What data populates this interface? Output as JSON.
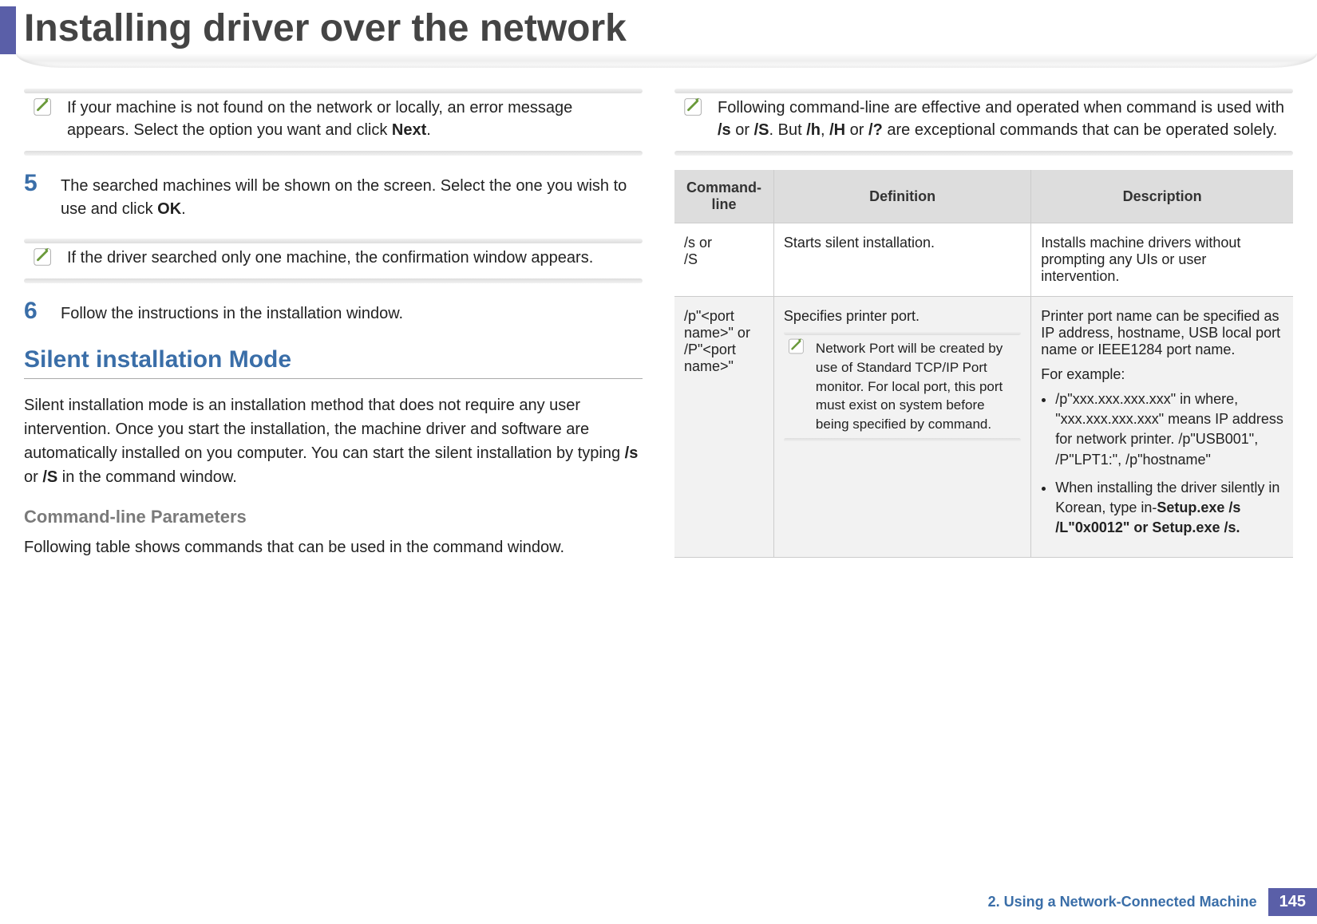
{
  "header": {
    "title": "Installing driver over the network"
  },
  "left": {
    "note1_a": "If your machine is not found on the network or locally, an error message appears. Select the option you want and click ",
    "note1_b": "Next",
    "note1_c": ".",
    "step5_num": "5",
    "step5_a": "The searched machines will be shown on the screen. Select the one you wish to use and click ",
    "step5_b": "OK",
    "step5_c": ".",
    "note2": "If the driver searched only one machine, the confirmation window appears.",
    "step6_num": "6",
    "step6": "Follow the instructions in the installation window.",
    "subheading": "Silent installation Mode",
    "para_a": "Silent installation mode is an installation method that does not require any user intervention. Once you start the installation, the machine driver and software are automatically installed on you computer. You can start the silent installation by typing ",
    "para_b": "/s",
    "para_c": " or ",
    "para_d": "/S",
    "para_e": " in the command window.",
    "subsub": "Command-line Parameters",
    "para2": "Following table shows commands that can be used in the command window."
  },
  "right": {
    "note_a": "Following command-line are effective and operated when command is used with ",
    "note_b": "/s",
    "note_c": " or ",
    "note_d": "/S",
    "note_e": ". But ",
    "note_f": "/h",
    "note_g": ", ",
    "note_h": "/H",
    "note_i": " or ",
    "note_j": "/?",
    "note_k": " are exceptional commands that can be operated solely.",
    "th1": "Command- line",
    "th2": "Definition",
    "th3": "Description",
    "r1c1_a": "/s or",
    "r1c1_b": "/S",
    "r1c2": "Starts silent installation.",
    "r1c3": "Installs machine drivers without prompting any UIs or user intervention.",
    "r2c1_a": "/p\"<port name>\" or",
    "r2c1_b": "/P\"<port name>\"",
    "r2c2": "Specifies printer port.",
    "r2c2_note": "Network Port will be created by use of Standard TCP/IP Port monitor. For local port, this port must exist on system before being specified by command.",
    "r2c3_a": "Printer port name can be specified as IP address, hostname, USB local port name or IEEE1284 port name.",
    "r2c3_b": "For example:",
    "r2c3_li1": "/p\"xxx.xxx.xxx.xxx\" in where, \"xxx.xxx.xxx.xxx\" means IP address for network printer. /p\"USB001\", /P\"LPT1:\", /p\"hostname\"",
    "r2c3_li2_a": "When installing the driver silently in Korean, type in-",
    "r2c3_li2_b": "Setup.exe /s /L\"0x0012\" or Setup.exe /s."
  },
  "footer": {
    "text": "2.  Using a Network-Connected Machine",
    "page": "145"
  }
}
